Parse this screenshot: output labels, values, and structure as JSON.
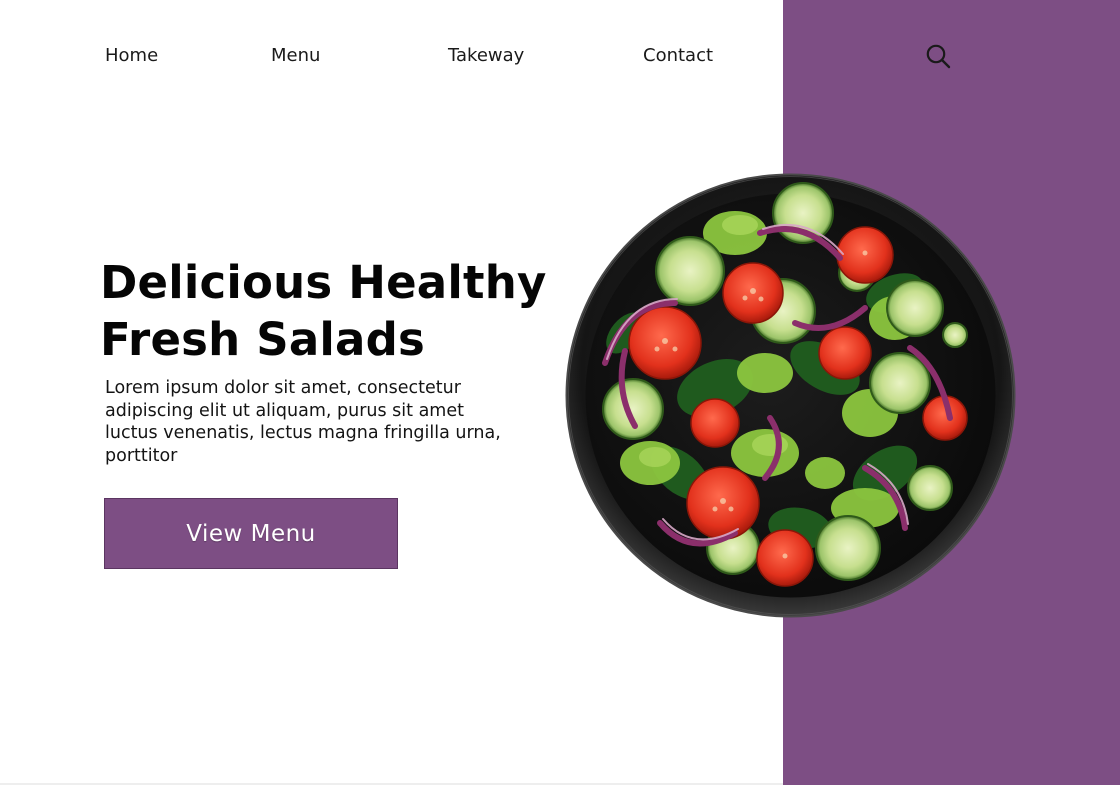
{
  "nav": {
    "items": [
      {
        "label": "Home"
      },
      {
        "label": "Menu"
      },
      {
        "label": "Takeway"
      },
      {
        "label": "Contact"
      }
    ],
    "search_icon": "search-icon"
  },
  "hero": {
    "title_line1": "Delicious Healthy",
    "title_line2": "Fresh Salads",
    "description": "Lorem ipsum dolor sit amet, consectetur adipiscing elit ut aliquam, purus sit amet luctus venenatis, lectus magna fringilla urna, porttitor",
    "cta_label": "View Menu",
    "image": "salad-bowl-image"
  },
  "colors": {
    "accent": "#7d4e84",
    "text": "#111111",
    "background": "#ffffff"
  }
}
